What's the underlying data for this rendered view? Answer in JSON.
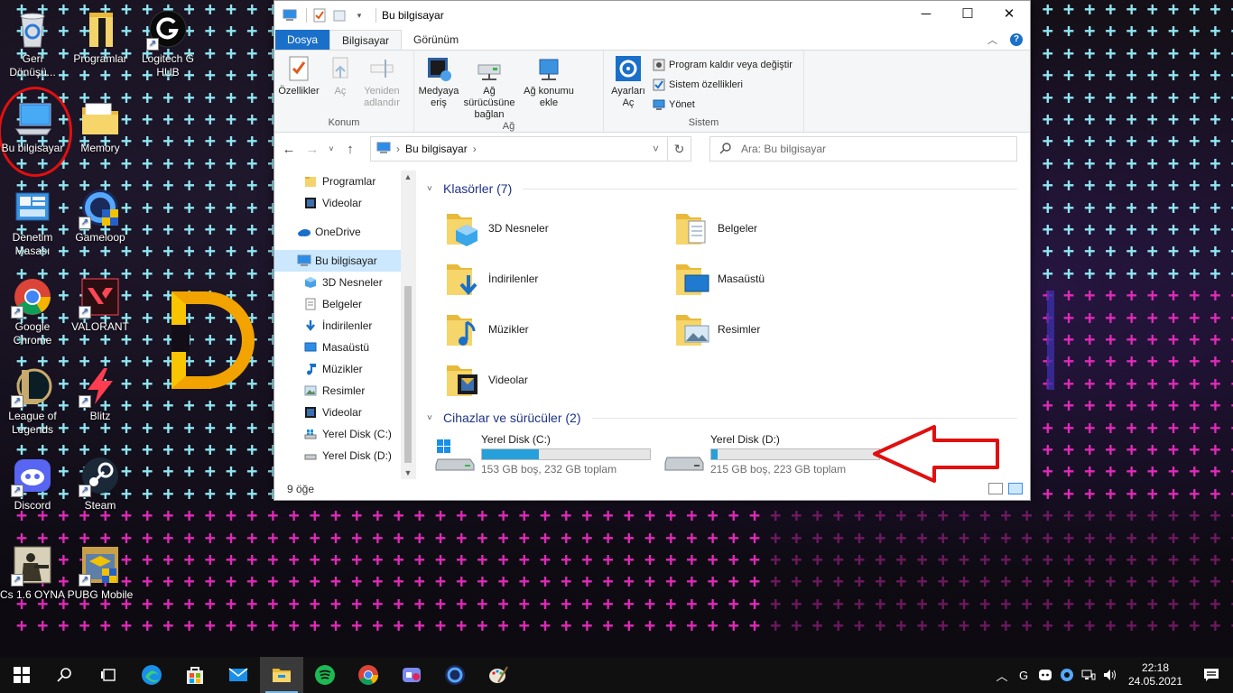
{
  "desktop": {
    "icons": [
      {
        "id": "recycle",
        "label": "Geri Dönüşü..."
      },
      {
        "id": "programlar",
        "label": "Programlar"
      },
      {
        "id": "logitech",
        "label": "Logitech G HUB"
      },
      {
        "id": "bilgisayar",
        "label": "Bu bilgisayar"
      },
      {
        "id": "memory",
        "label": "Memory"
      },
      {
        "id": "denetim",
        "label": "Denetim Masası"
      },
      {
        "id": "gameloop",
        "label": "Gameloop"
      },
      {
        "id": "chrome",
        "label": "Google Chrome"
      },
      {
        "id": "valorant",
        "label": "VALORANT"
      },
      {
        "id": "lol",
        "label": "League of Legends"
      },
      {
        "id": "blitz",
        "label": "Blitz"
      },
      {
        "id": "discord",
        "label": "Discord"
      },
      {
        "id": "steam",
        "label": "Steam"
      },
      {
        "id": "cs",
        "label": "Cs 1.6 OYNA"
      },
      {
        "id": "pubg",
        "label": "PUBG Mobile"
      }
    ]
  },
  "explorer": {
    "title": "Bu bilgisayar",
    "tabs": {
      "file": "Dosya",
      "computer": "Bilgisayar",
      "view": "Görünüm"
    },
    "ribbon": {
      "konum": {
        "label": "Konum",
        "buttons": [
          "Özellikler",
          "Aç",
          "Yeniden adlandır"
        ]
      },
      "ag": {
        "label": "Ağ",
        "buttons": [
          "Medyaya eriş",
          "Ağ sürücüsüne bağlan",
          "Ağ konumu ekle"
        ]
      },
      "sistem": {
        "label": "Sistem",
        "open_settings": "Ayarları Aç",
        "small": [
          "Program kaldır veya değiştir",
          "Sistem özellikleri",
          "Yönet"
        ]
      }
    },
    "address": {
      "path": "Bu bilgisayar",
      "separator": "›"
    },
    "search": {
      "placeholder": "Ara: Bu bilgisayar"
    },
    "nav": {
      "items": [
        "Programlar",
        "Videolar",
        "OneDrive",
        "Bu bilgisayar",
        "3D Nesneler",
        "Belgeler",
        "İndirilenler",
        "Masaüstü",
        "Müzikler",
        "Resimler",
        "Videolar",
        "Yerel Disk (C:)",
        "Yerel Disk (D:)"
      ]
    },
    "folders_header": "Klasörler (7)",
    "folders": [
      "3D Nesneler",
      "Belgeler",
      "İndirilenler",
      "Masaüstü",
      "Müzikler",
      "Resimler",
      "Videolar"
    ],
    "drives_header": "Cihazlar ve sürücüler (2)",
    "drives": [
      {
        "name": "Yerel Disk (C:)",
        "info": "153 GB boş, 232 GB toplam",
        "used_fraction": 0.34
      },
      {
        "name": "Yerel Disk (D:)",
        "info": "215 GB boş, 223 GB toplam",
        "used_fraction": 0.036
      }
    ],
    "status": "9 öğe"
  },
  "taskbar": {
    "time": "22:18",
    "date": "24.05.2021"
  },
  "colors": {
    "accent": "#1a6fc9",
    "annotation_red": "#e01010",
    "drive_fill": "#26a0da"
  }
}
